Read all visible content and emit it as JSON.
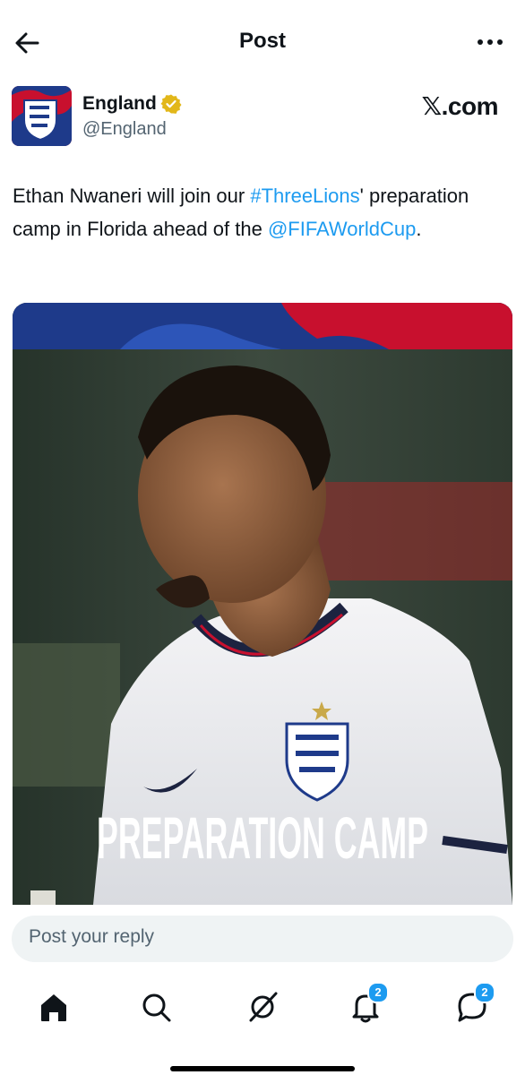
{
  "header": {
    "title": "Post"
  },
  "author": {
    "name": "England",
    "handle": "@England"
  },
  "brand": {
    "x_glyph": "𝕏",
    "suffix": ".com"
  },
  "tweet": {
    "part1": "Ethan Nwaneri will join our ",
    "hashtag": "#ThreeLions",
    "part2": "' preparation camp in Florida ahead of the ",
    "mention": "@FIFAWorldCup",
    "part3": "."
  },
  "media": {
    "overlay_text": "PREPARATION CAMP"
  },
  "reply": {
    "placeholder": "Post your reply"
  },
  "tabbar": {
    "notifications_badge": "2",
    "messages_badge": "2"
  },
  "colors": {
    "accent": "#1d9bf0",
    "verified": "#e2b719",
    "england_red": "#d52b2b",
    "england_blue": "#1e3a8a"
  }
}
